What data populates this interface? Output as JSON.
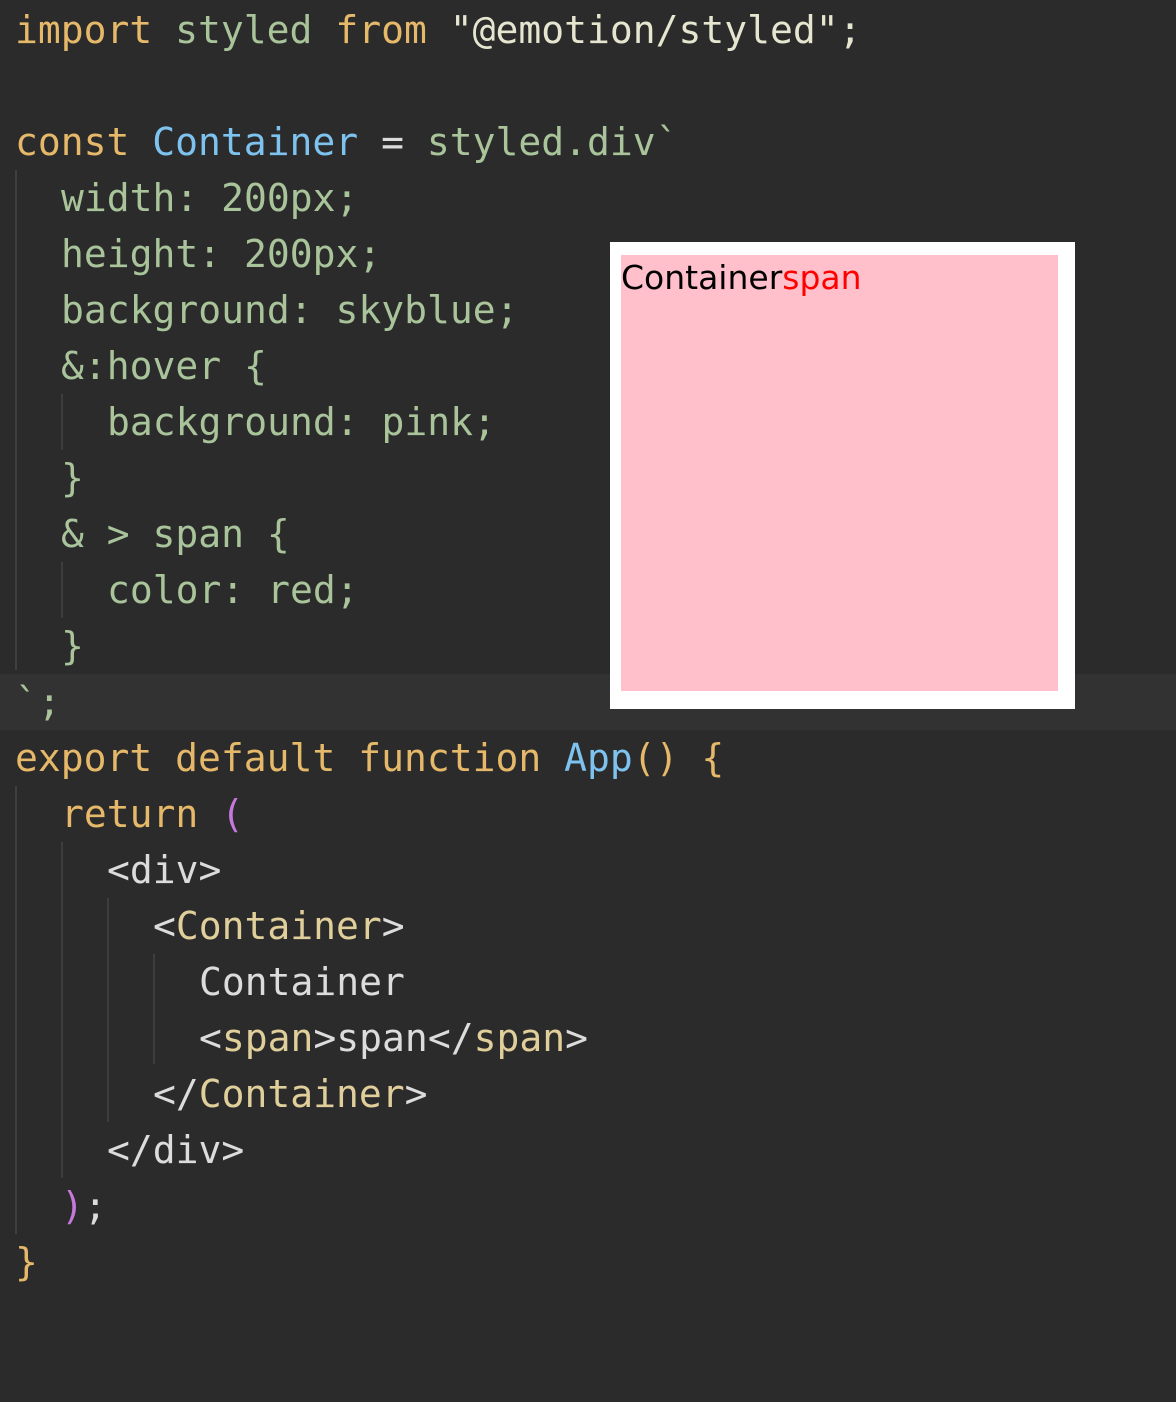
{
  "code": {
    "l1": {
      "kw_import": "import",
      "name": "styled",
      "kw_from": "from",
      "module": "\"@emotion/styled\";"
    },
    "l3": {
      "kw_const": "const",
      "name": "Container",
      "eq": " = ",
      "tpl": "styled.div`"
    },
    "l4": "width: 200px;",
    "l5": "height: 200px;",
    "l6": "background: skyblue;",
    "l7": "&:hover {",
    "l8": "background: pink;",
    "l9": "}",
    "l10": "& > span {",
    "l11": "color: red;",
    "l12": "}",
    "l13": "`;",
    "l14": {
      "kw_export": "export",
      "kw_default": "default",
      "kw_function": "function",
      "name": "App",
      "tail": "() {"
    },
    "l15": {
      "kw_return": "return",
      "paren": "("
    },
    "l16": "<div>",
    "l17": {
      "lt": "<",
      "tag": "Container",
      "gt": ">"
    },
    "l18": "Container",
    "l19": {
      "open_lt": "<",
      "open_tag": "span",
      "open_gt": ">",
      "text": "span",
      "close_lt": "</",
      "close_tag": "span",
      "close_gt": ">"
    },
    "l20": {
      "lt": "</",
      "tag": "Container",
      "gt": ">"
    },
    "l21": "</div>",
    "l22": {
      "paren": ")",
      "semi": ";"
    },
    "l23": "}"
  },
  "preview": {
    "text": "Container",
    "span": "span"
  },
  "colors": {
    "editor_bg": "#2b2b2b",
    "keyword": "#e5b86a",
    "class_name": "#7ec3f0",
    "css_text": "#a9c49a",
    "preview_bg": "#ffc0cb",
    "span_color": "#ff0000"
  }
}
